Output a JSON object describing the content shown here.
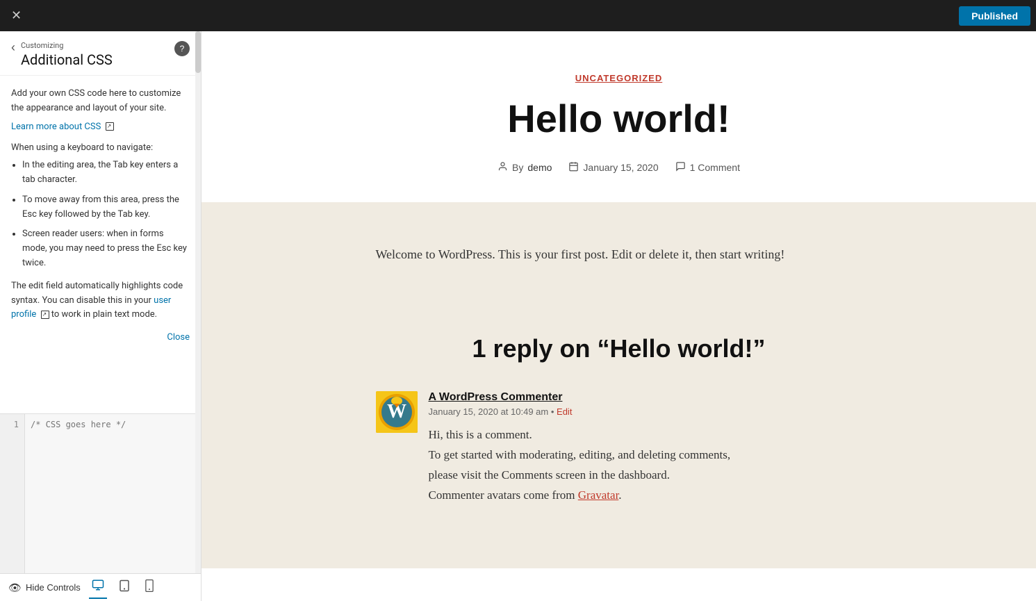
{
  "topbar": {
    "close_label": "✕",
    "published_label": "Published"
  },
  "sidebar": {
    "customizing_label": "Customizing",
    "main_title": "Additional CSS",
    "help_label": "?",
    "description": "Add your own CSS code here to customize the appearance and layout of your site.",
    "learn_more_text": "Learn more about CSS",
    "keyboard_hint_title": "When using a keyboard to navigate:",
    "keyboard_hints": [
      "In the editing area, the Tab key enters a tab character.",
      "To move away from this area, press the Esc key followed by the Tab key.",
      "Screen reader users: when in forms mode, you may need to press the Esc key twice."
    ],
    "edit_field_note": "The edit field automatically highlights code syntax. You can disable this in your",
    "user_profile_link": "user profile",
    "plain_text_note": "to work in plain text mode.",
    "close_link": "Close",
    "line_number": "1"
  },
  "bottom_bar": {
    "hide_controls_label": "Hide Controls",
    "device_desktop_label": "Desktop",
    "device_tablet_label": "Tablet",
    "device_mobile_label": "Mobile"
  },
  "preview": {
    "category": "UNCATEGORIZED",
    "title": "Hello world!",
    "meta_author_prefix": "By",
    "meta_author": "demo",
    "meta_date": "January 15, 2020",
    "meta_comments": "1 Comment",
    "post_content": "Welcome to WordPress. This is your first post. Edit or delete it, then start writing!",
    "comments_title": "1 reply on “Hello world!”",
    "comment": {
      "author_name": "A WordPress Commenter",
      "date": "January 15, 2020 at 10:49 am",
      "edit_label": "Edit",
      "line1": "Hi, this is a comment.",
      "line2": "To get started with moderating, editing, and deleting comments,",
      "line3": "please visit the Comments screen in the dashboard.",
      "line4_prefix": "Commenter avatars come from",
      "gravatar_link": "Gravatar",
      "line4_suffix": "."
    }
  }
}
